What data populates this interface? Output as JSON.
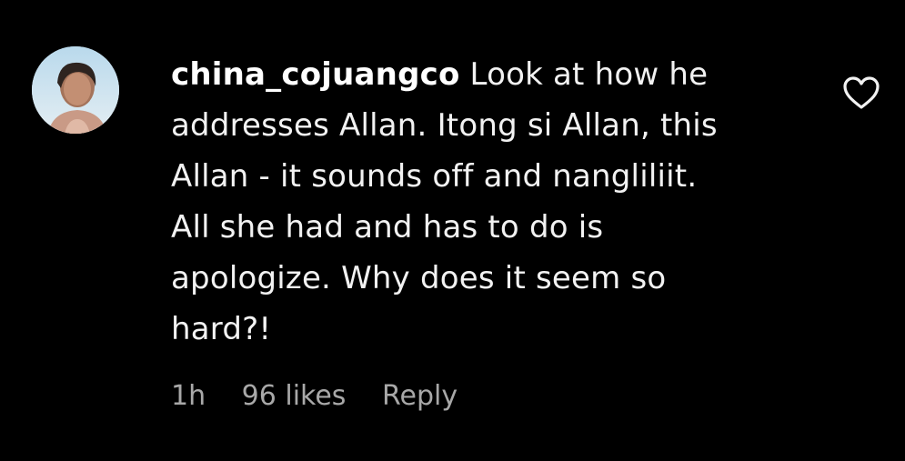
{
  "comment": {
    "username": "china_cojuangco",
    "lines": [
      " Look at how he",
      "addresses Allan. Itong si Allan, this",
      "Allan - it sounds off and nangliliit.",
      "All she had and has to do is",
      "apologize. Why does it seem so",
      "hard?!"
    ],
    "time": "1h",
    "likes": "96 likes",
    "reply_label": "Reply",
    "like_icon": "heart-outline-icon"
  },
  "colors": {
    "background": "#000000",
    "text": "#f2f2f2",
    "meta": "#a8a8a8"
  }
}
